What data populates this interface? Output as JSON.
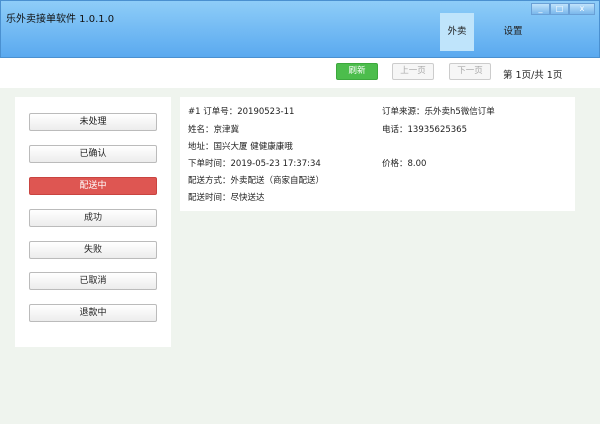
{
  "window": {
    "title": "乐外卖接单软件 1.0.1.0",
    "minimize": "_",
    "maximize": "□",
    "close": "x"
  },
  "tabs": [
    {
      "label": "外卖",
      "active": true
    },
    {
      "label": "设置",
      "active": false
    }
  ],
  "toolbar": {
    "refresh": "刷新",
    "prev": "上一页",
    "next": "下一页",
    "pager": "第 1页/共 1页"
  },
  "status_buttons": [
    {
      "label": "未处理"
    },
    {
      "label": "已确认"
    },
    {
      "label": "配送中",
      "active": true
    },
    {
      "label": "成功"
    },
    {
      "label": "失败"
    },
    {
      "label": "已取消"
    },
    {
      "label": "退款中"
    }
  ],
  "order": {
    "number": "#1  订单号：20190523-11",
    "source": "订单来源：乐外卖h5微信订单",
    "name": "姓名：京津冀",
    "phone": "电话：13935625365",
    "address": "地址：国兴大厦 健健康康哦",
    "time": "下单时间：2019-05-23 17:37:34",
    "price": "价格：8.00",
    "delivery_method": "配送方式：外卖配送（商家自配送）",
    "delivery_time": "配送时间：尽快送达"
  },
  "colors": {
    "accent_green": "#4cbd4c",
    "active_red": "#de5652",
    "titlebar": "#5aa9ef"
  }
}
